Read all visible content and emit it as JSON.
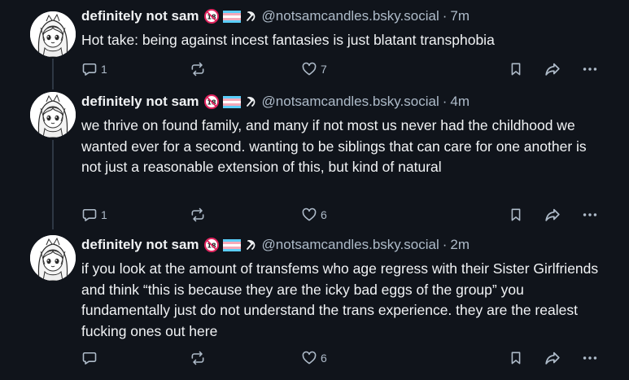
{
  "posts": [
    {
      "display_name": "definitely not sam",
      "handle": "@notsamcandles.bsky.social",
      "separator": "·",
      "time": "7m",
      "text": "Hot take: being against incest fantasies is just blatant transphobia",
      "reply_count": "1",
      "repost_count": "",
      "like_count": "7"
    },
    {
      "display_name": "definitely not sam",
      "handle": "@notsamcandles.bsky.social",
      "separator": "·",
      "time": "4m",
      "text": "we thrive on found family, and many if not most us never had the childhood we wanted ever for a second. wanting to be siblings that can care for one another is not just a reasonable extension of this, but kind of natural",
      "reply_count": "1",
      "repost_count": "",
      "like_count": "6"
    },
    {
      "display_name": "definitely not sam",
      "handle": "@notsamcandles.bsky.social",
      "separator": "·",
      "time": "2m",
      "text": "if you look at the amount of transfems who age regress with their Sister Girlfriends and think “this is because they are the icky bad eggs of the group” you fundamentally just do not understand the trans experience. they are the realest fucking ones out here",
      "reply_count": "",
      "repost_count": "",
      "like_count": "6"
    }
  ],
  "icons": {
    "badge_1": "no-under-18-emoji",
    "badge_2": "trans-flag-emoji",
    "badge_3": "hammer-and-sickle-emoji",
    "reply": "reply-bubble-icon",
    "repost": "repost-icon",
    "like": "heart-icon",
    "bookmark": "bookmark-icon",
    "share": "share-arrow-icon",
    "more": "more-dots-icon"
  },
  "colors": {
    "background": "#10141b",
    "text": "#f1f3f5",
    "muted": "#aebbc9",
    "thread_line": "#2e3744",
    "trans_blue": "#5bcefa",
    "trans_pink": "#f5a9b8"
  }
}
